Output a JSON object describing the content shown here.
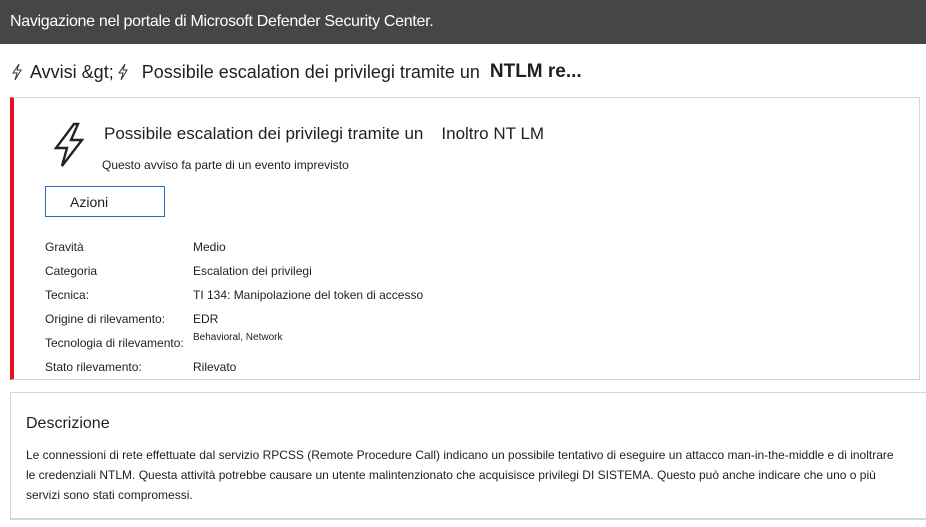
{
  "window": {
    "title": "Navigazione nel portale di Microsoft Defender Security Center."
  },
  "breadcrumb": {
    "parent": "Avvisi &gt;",
    "title": "Possibile escalation dei privilegi tramite un",
    "title_bold": "NTLM re..."
  },
  "alert": {
    "title": "Possibile escalation dei privilegi tramite un",
    "title_extra": "Inoltro NT LM",
    "subtitle": "Questo avviso fa parte di un evento imprevisto",
    "actions_label": "Azioni",
    "accent_color": "#e81123",
    "icon": "lightning-bolt-icon",
    "properties": [
      {
        "label": "Gravità",
        "value": "Medio"
      },
      {
        "label": "Categoria",
        "value": "Escalation dei privilegi"
      },
      {
        "label": "Tecnica:",
        "value": "TI 134: Manipolazione del token di accesso"
      },
      {
        "label": "Origine di rilevamento:",
        "value": "EDR"
      },
      {
        "label": "Tecnologia di rilevamento:",
        "value": "Behavioral, Network"
      },
      {
        "label": "Stato rilevamento:",
        "value": "Rilevato"
      }
    ]
  },
  "description": {
    "title": "Descrizione",
    "text": "Le connessioni di rete effettuate dal servizio RPCSS (Remote Procedure Call) indicano un possibile tentativo di eseguire un attacco man-in-the-middle e di inoltrare le credenziali NTLM. Questa attività potrebbe causare un utente malintenzionato che acquisisce privilegi DI SISTEMA. Questo può anche indicare che uno o più servizi sono stati compromessi."
  }
}
